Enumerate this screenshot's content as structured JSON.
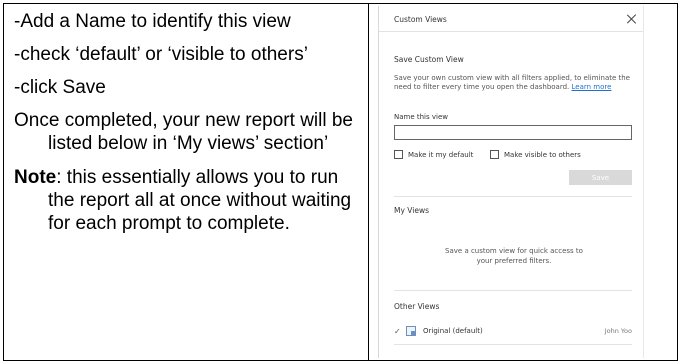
{
  "instructions": {
    "step1": "-Add a Name to identify this view",
    "step2": "-check ‘default’ or ‘visible to others’",
    "step3": "-click Save",
    "completed": "Once completed, your new report will be listed below in ‘My views’ section’",
    "note_label": "Note",
    "note_text": ": this essentially allows you to run the report all at once without waiting for each prompt to complete."
  },
  "dialog": {
    "title": "Custom Views",
    "close_icon": "close-icon",
    "save_section": {
      "title": "Save Custom View",
      "description": "Save your own custom view with all filters applied, to eliminate the need to filter every time you open the dashboard. ",
      "learn_more": "Learn more",
      "name_label": "Name this view",
      "name_value": "",
      "default_label": "Make it my default",
      "visible_label": "Make visible to others",
      "save_label": "Save"
    },
    "my_views": {
      "title": "My Views",
      "empty_message": "Save a custom view for quick access to your preferred filters."
    },
    "other_views": {
      "title": "Other Views",
      "items": [
        {
          "name": "Original (default)",
          "owner": "John Yoo",
          "selected": true
        }
      ]
    }
  },
  "colors": {
    "link": "#1f6fd1",
    "save_button_disabled": "#d9d9d9"
  }
}
